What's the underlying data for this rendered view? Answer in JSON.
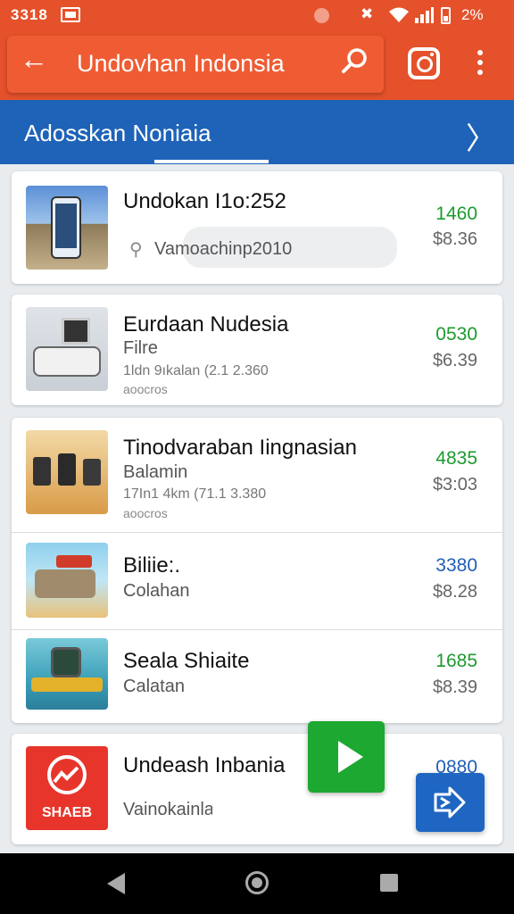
{
  "status_bar": {
    "time": "3318",
    "battery_text": "2%"
  },
  "app_bar": {
    "title": "Undovhan Indonsia"
  },
  "tab_bar": {
    "label": "Adosskan Noniaia"
  },
  "listings": [
    {
      "name": "Undokan I1o:252",
      "subtitle": "Vamoachinp2010",
      "price": "1460",
      "old_price": "$8.36",
      "price_color": "#1b9b2e"
    },
    {
      "name": "Eurdaan Nudesia",
      "subtitle": "Filre",
      "meta": "1ldn 9ıkalan (2.1 2.360",
      "tiny": "aoocros",
      "price": "0530",
      "old_price": "$6.39",
      "price_color": "#1b9b2e"
    },
    {
      "name": "Tinodvaraban Iingnasian",
      "subtitle": "Balamin",
      "meta": "17In1 4km (71.1 3.380",
      "tiny": "aoocros",
      "price": "4835",
      "old_price": "$3:03",
      "price_color": "#1b9b2e"
    },
    {
      "name": "Biliie:.",
      "subtitle": "Colahan",
      "price": "3380",
      "old_price": "$8.28",
      "price_color": "#1f5fb8"
    },
    {
      "name": "Seala Shiaite",
      "subtitle": "Calatan",
      "price": "1685",
      "old_price": "$8.39",
      "price_color": "#1b9b2e"
    },
    {
      "name": "Undeash Inbania",
      "subtitle": "Vainokainlan: 301",
      "price": "0880",
      "price_color": "#1f5fb8",
      "logo_text": "SHAEB"
    }
  ]
}
